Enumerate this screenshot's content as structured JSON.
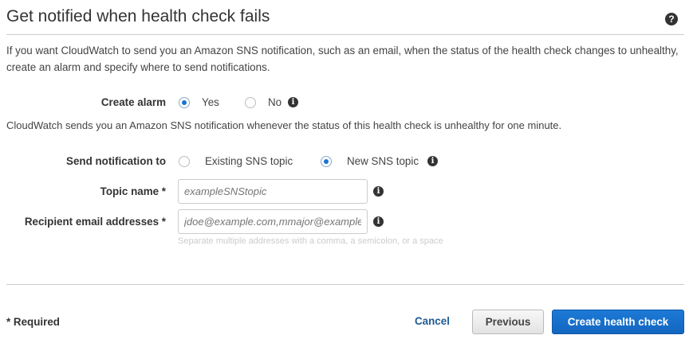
{
  "header": {
    "title": "Get notified when health check fails",
    "help_icon": "question-circle-icon"
  },
  "description": "If you want CloudWatch to send you an Amazon SNS notification, such as an email, when the status of the health check changes to unhealthy, create an alarm and specify where to send notifications.",
  "create_alarm": {
    "label": "Create alarm",
    "options": [
      "Yes",
      "No"
    ],
    "selected": "Yes",
    "info_icon": "info-circle-icon"
  },
  "alarm_note": "CloudWatch sends you an Amazon SNS notification whenever the status of this health check is unhealthy for one minute.",
  "send_notification": {
    "label": "Send notification to",
    "options": [
      "Existing SNS topic",
      "New SNS topic"
    ],
    "selected": "New SNS topic"
  },
  "topic_name": {
    "label": "Topic name *",
    "value": "",
    "placeholder": "exampleSNStopic"
  },
  "recipient_emails": {
    "label": "Recipient email addresses *",
    "value": "",
    "placeholder": "jdoe@example.com,mmajor@example.com",
    "hint": "Separate multiple addresses with a comma, a semicolon, or a space"
  },
  "footer": {
    "required_note": "* Required",
    "cancel_label": "Cancel",
    "previous_label": "Previous",
    "create_label": "Create health check"
  },
  "colors": {
    "primary_button": "#1266bf",
    "link": "#1f5a96",
    "radio_selected": "#1a73d1"
  }
}
